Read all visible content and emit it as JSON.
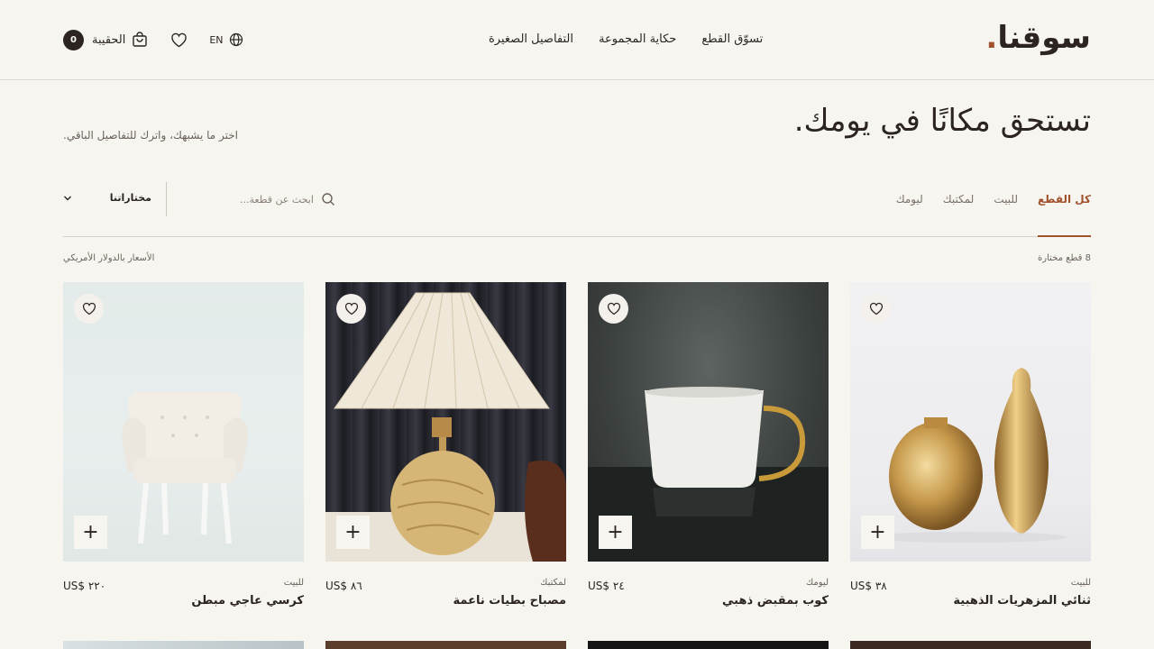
{
  "brand": {
    "name": "سوقنا",
    "dot": "."
  },
  "nav": {
    "items": [
      "تسوّق القطع",
      "حكاية المجموعة",
      "التفاصيل الصغيرة"
    ]
  },
  "header": {
    "bag_label": "الحقيبة",
    "bag_count": "0",
    "lang": "EN"
  },
  "hero": {
    "title": "تستحق مكانًا في يومك.",
    "subtitle": "اختر ما يشبهك، واترك للتفاصيل الباقي."
  },
  "filters": {
    "tabs": [
      "كل القطع",
      "للبيت",
      "لمكتبك",
      "ليومك"
    ],
    "active_tab": "كل القطع",
    "search_placeholder": "ابحث عن قطعة...",
    "sort_label": "مختاراتنا"
  },
  "listing": {
    "count": "8 قطع مختارة",
    "currency_note": "الأسعار بالدولار الأمريكي"
  },
  "products": [
    {
      "category": "للبيت",
      "name": "ثنائي المزهريات الذهبية",
      "price": "US$ ٣٨"
    },
    {
      "category": "ليومك",
      "name": "كوب بمقبض ذهبي",
      "price": "US$ ٢٤"
    },
    {
      "category": "لمكتبك",
      "name": "مصباح بطيات ناعمة",
      "price": "US$ ٨٦"
    },
    {
      "category": "للبيت",
      "name": "كرسي عاجي مبطن",
      "price": "US$ ٢٢٠"
    }
  ],
  "icons": {
    "bag": "shopping-bag-icon",
    "heart": "heart-icon",
    "globe": "globe-icon",
    "search": "search-icon",
    "chevron": "chevron-down-icon",
    "plus": "plus-icon"
  },
  "colors": {
    "accent": "#a0522d",
    "background": "#f7f5f0",
    "text": "#2b2420"
  }
}
